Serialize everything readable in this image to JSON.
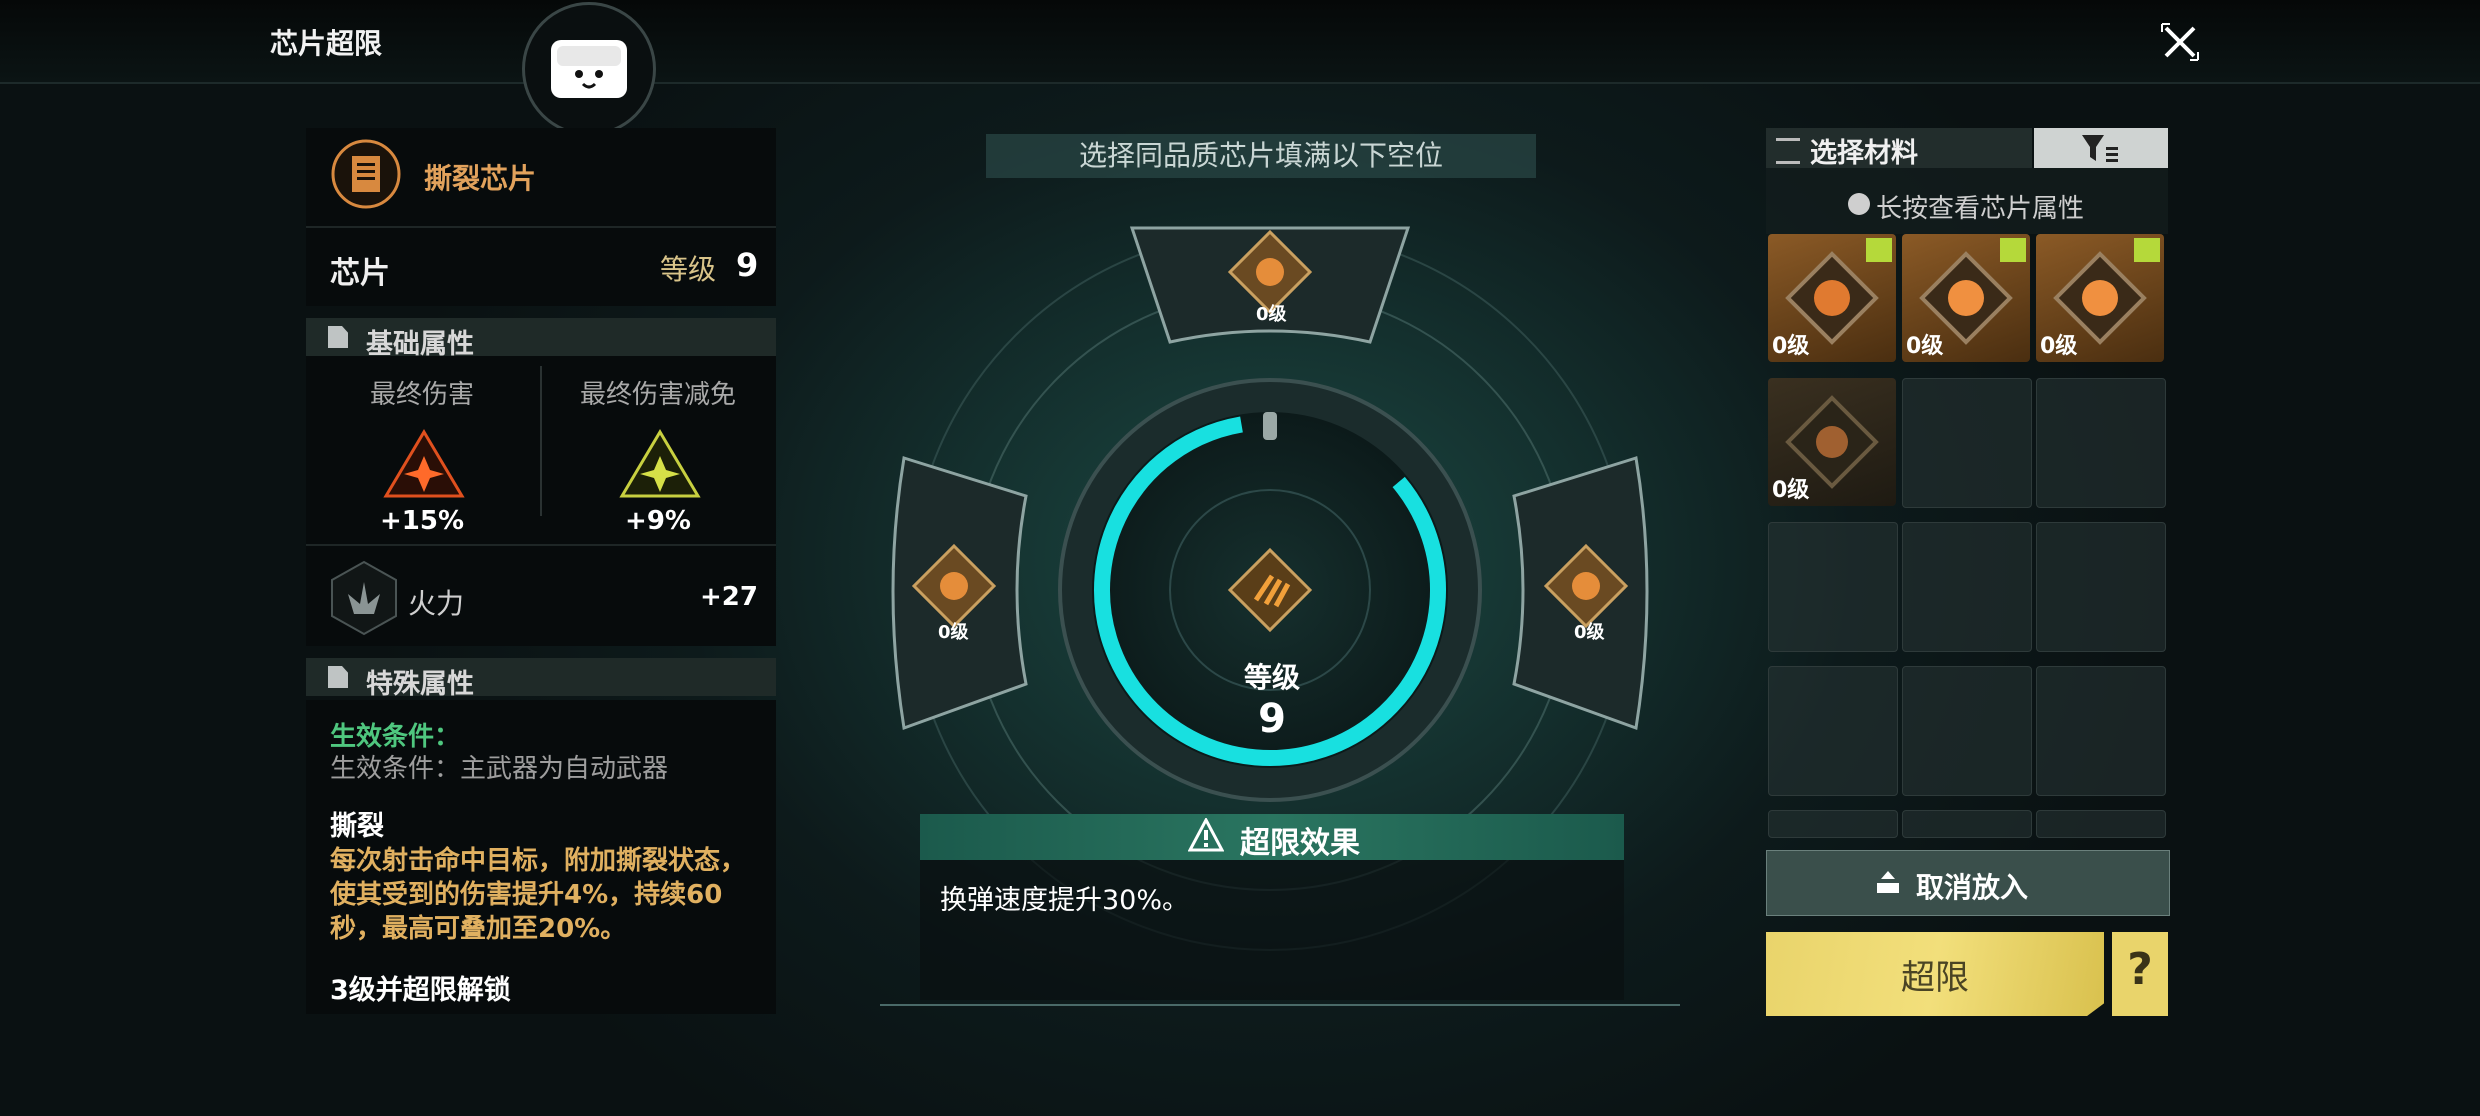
{
  "header": {
    "title": "芯片超限"
  },
  "chip": {
    "name": "撕裂芯片",
    "type": "芯片",
    "level_label": "等级",
    "level_value": "9"
  },
  "base_attributes": {
    "section_title": "基础属性",
    "final_damage_label": "最终伤害",
    "final_damage_value": "+15%",
    "final_damage_reduction_label": "最终伤害减免",
    "final_damage_reduction_value": "+9%",
    "firepower_label": "火力",
    "firepower_value": "+27"
  },
  "special_attributes": {
    "section_title": "特殊属性",
    "condition_title": "生效条件：",
    "condition_text": "生效条件：主武器为自动武器",
    "tear_title": "撕裂",
    "tear_text": "每次射击命中目标，附加撕裂状态，使其受到的伤害提升4%，持续60秒，最高可叠加至20%。",
    "unlock_title": "3级并超限解锁"
  },
  "center": {
    "banner": "选择同品质芯片填满以下空位",
    "level_label": "等级",
    "level_value": "9",
    "slots": [
      {
        "level": "0级"
      },
      {
        "level": "0级"
      },
      {
        "level": "0级"
      }
    ],
    "effect_title": "超限效果",
    "effect_text": "换弹速度提升30%。"
  },
  "materials": {
    "tab_label": "选择材料",
    "hint": "长按查看芯片属性",
    "items": [
      {
        "level": "0级",
        "selected": true
      },
      {
        "level": "0级",
        "selected": true
      },
      {
        "level": "0级",
        "selected": true
      },
      {
        "level": "0级",
        "selected": false
      }
    ]
  },
  "actions": {
    "cancel_label": "取消放入",
    "limit_label": "超限",
    "help_label": "?"
  },
  "colors": {
    "accent_cyan": "#18e0e0",
    "gold": "#e9d46b",
    "orange_text": "#e2a25c",
    "green_text": "#4fc77f"
  }
}
